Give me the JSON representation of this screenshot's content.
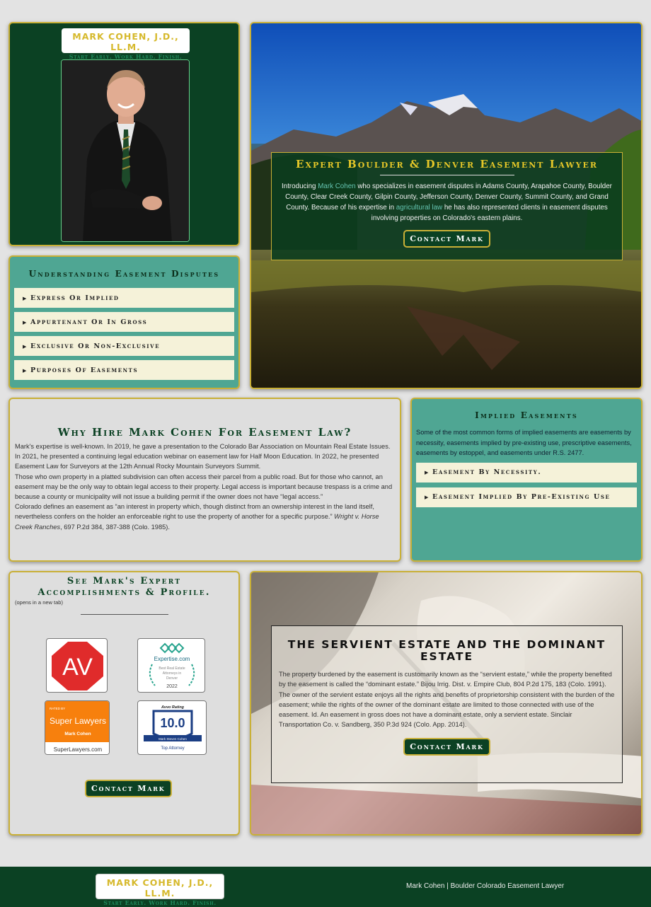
{
  "brand": {
    "name": "MARK COHEN, J.D., LL.M.",
    "tagline": "Start Early. Work Hard. Finish. ®"
  },
  "understanding": {
    "title": "Understanding Easement Disputes",
    "items": [
      "Express Or Implied",
      "Appurtenant Or In Gross",
      "Exclusive Or Non-Exclusive",
      "Purposes Of Easements"
    ]
  },
  "hero": {
    "title": "Expert Boulder & Denver Easement Lawyer",
    "p_intro": "Introducing ",
    "p_link1": "Mark Cohen",
    "p_mid": " who specializes in easement disputes in Adams County, Arapahoe County, Boulder County, Clear Creek County, Gilpin County, Jefferson County, Denver County, Summit County, and Grand County. Because of his expertise in ",
    "p_link2": "agricultural law",
    "p_end": " he has also represented clients in easement disputes involving properties on Colorado's eastern plains.",
    "button": "Contact Mark"
  },
  "why": {
    "title": "Why Hire Mark Cohen For Easement Law?",
    "p1": "Mark's expertise is well-known. In 2019, he gave a presentation to the Colorado Bar Association on Mountain Real Estate Issues. In 2021, he presented a continuing legal education webinar on easement law for Half Moon Education. In 2022, he presented Easement Law for Surveyors at the 12th Annual Rocky Mountain Surveyors Summit.",
    "p2": "Those who own property in a platted subdivision can often access their parcel from a public road. But for those who cannot, an easement may be the only way to obtain legal access to their property. Legal access is important because trespass is a crime and because a county or municipality will not issue a building permit if the owner does not have “legal access.”",
    "p3_start": "Colorado defines an easement as “an interest in property which, though distinct from an ownership interest in the land itself, nevertheless confers on the holder an enforceable right to use the property of another for a specific purpose.” ",
    "p3_case": "Wright v. Horse Creek Ranches",
    "p3_end": ", 697 P.2d 384, 387-388 (Colo. 1985)."
  },
  "implied": {
    "title": "Implied Easements",
    "text": "Some of the most common forms of implied easements are easements by necessity, easements implied by pre-existing use, prescriptive easements, easements by estoppel, and easements under R.S. 2477.",
    "items": [
      "Easement By Necessity.",
      "Easement Implied By Pre-Existing Use"
    ]
  },
  "accomplishments": {
    "title": "See Mark's Expert Accomplishments & Profile.",
    "note": "(opens in a new tab)",
    "av_text": "AV",
    "expertise": {
      "brand": "Expertise.com",
      "line1": "Best Real Estate",
      "line2": "Attorneys in",
      "line3": "Denver",
      "year": "2022"
    },
    "superlawyers": {
      "rated": "RATED BY",
      "brand": "Super Lawyers",
      "name": "Mark Cohen",
      "url": "SuperLawyers.com"
    },
    "avvo": {
      "brand": "Avvo Rating",
      "score": "10.0",
      "name": "Mark Steven Cohen",
      "label": "Top Attorney"
    },
    "button": "Contact Mark"
  },
  "servient": {
    "title": "The Servient Estate and the Dominant Estate",
    "p1": "The property burdened by the easement is customarily known as the “servient estate,” while the property benefited by the easement is called the “dominant estate.” Bijou Irrig. Dist. v. Empire Club, 804 P.2d 175, 183 (Colo. 1991).",
    "p2": "The owner of the servient estate enjoys all the rights and benefits of proprietorship consistent with the burden of the easement; while the rights of the owner of the dominant estate are limited to those connected with use of the easement. Id. An easement in gross does not have a dominant estate, only a servient estate. Sinclair Transportation Co. v. Sandberg, 350 P.3d 924 (Colo. App. 2014).",
    "button": "Contact Mark"
  },
  "footer": {
    "text": "Mark Cohen | Boulder Colorado Easement Lawyer"
  },
  "colors": {
    "green": "#0b4123",
    "gold": "#c9b037",
    "teal": "#4fa693",
    "cream": "#f5f2d9"
  }
}
